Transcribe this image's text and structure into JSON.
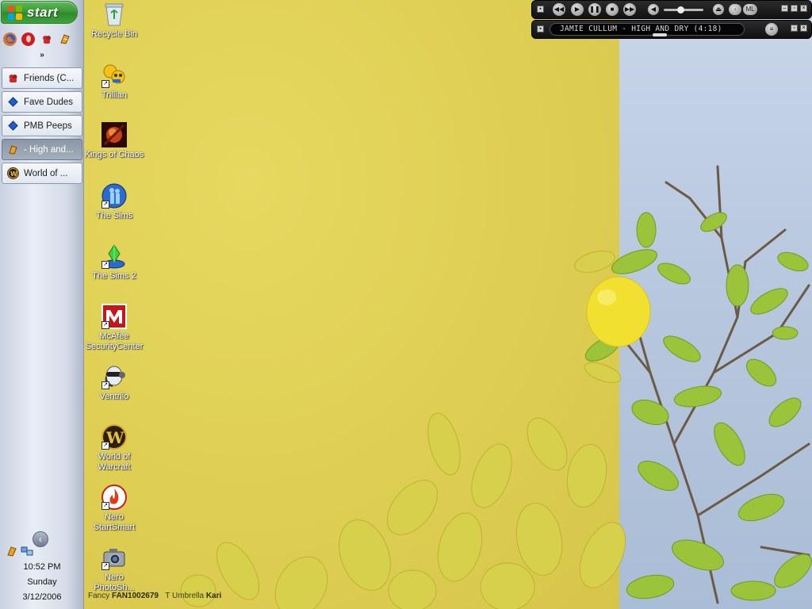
{
  "taskbar": {
    "start_label": "start",
    "quick_launch": [
      "firefox-icon",
      "opera-icon",
      "msn-icon",
      "winamp-icon"
    ],
    "expand_glyph": "»",
    "tasks": [
      {
        "label": "Friends (C...",
        "icon": "msn-icon",
        "active": false
      },
      {
        "label": "Fave Dudes",
        "icon": "blue-diamond-icon",
        "active": false
      },
      {
        "label": "PMB Peeps",
        "icon": "blue-diamond-icon",
        "active": false
      },
      {
        "label": "- High and...",
        "icon": "winamp-icon",
        "active": true
      },
      {
        "label": "World of ...",
        "icon": "warcraft-icon",
        "active": false
      }
    ],
    "tray": {
      "time": "10:52 PM",
      "day": "Sunday",
      "date": "3/12/2006"
    }
  },
  "desktop_icons": [
    {
      "label": "Recycle Bin"
    },
    {
      "label": "Trillian"
    },
    {
      "label": "Kings of Chaos"
    },
    {
      "label": "The Sims"
    },
    {
      "label": "The Sims 2"
    },
    {
      "label": "McAfee SecurityCenter"
    },
    {
      "label": "Ventrilo"
    },
    {
      "label": "World of Warcraft"
    },
    {
      "label": "Nero StartSmart"
    },
    {
      "label": "Nero PhotoSh..."
    }
  ],
  "winamp": {
    "now_playing": "JAMIE CULLUM - HIGH AND DRY (4:18)",
    "ml_label": "ML",
    "colors": {
      "body": "#1a1a1a",
      "display_text": "#d8d8d8"
    }
  },
  "credits": {
    "part1": "Fancy",
    "part2": "FAN1002679",
    "part3": "Umbrella",
    "part4": "Kari"
  }
}
